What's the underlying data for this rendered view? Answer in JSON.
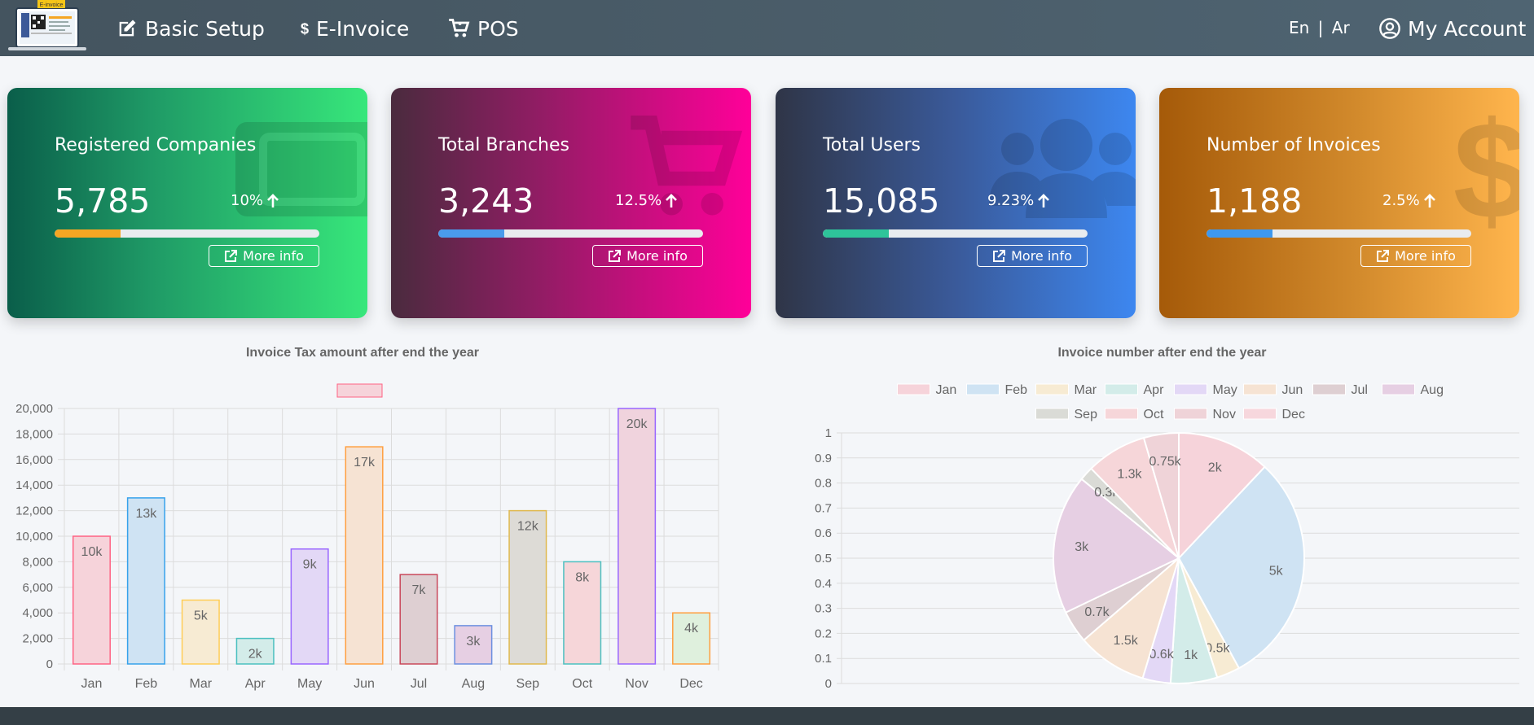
{
  "nav": {
    "logo_badge": "E-invoice",
    "items": [
      {
        "label": "Basic Setup",
        "icon": "edit-icon"
      },
      {
        "label": "E-Invoice",
        "icon": "dollar-icon"
      },
      {
        "label": "POS",
        "icon": "cart-icon"
      }
    ],
    "lang_en": "En",
    "lang_sep": "|",
    "lang_ar": "Ar",
    "account": "My Account"
  },
  "cards": [
    {
      "title": "Registered Companies",
      "value": "5,785",
      "pct": "10%",
      "progress": 0.25,
      "bar_color": "#f5a623",
      "more": "More info",
      "icon": "laptop-icon"
    },
    {
      "title": "Total Branches",
      "value": "3,243",
      "pct": "12.5%",
      "progress": 0.25,
      "bar_color": "#4a9bec",
      "more": "More info",
      "icon": "cart-icon"
    },
    {
      "title": "Total Users",
      "value": "15,085",
      "pct": "9.23%",
      "progress": 0.25,
      "bar_color": "#2ec49a",
      "more": "More info",
      "icon": "users-icon"
    },
    {
      "title": "Number of Invoices",
      "value": "1,188",
      "pct": "2.5%",
      "progress": 0.25,
      "bar_color": "#3d98ef",
      "more": "More info",
      "icon": "dollar-icon"
    }
  ],
  "chart_data": [
    {
      "type": "bar",
      "title": "Invoice Tax amount after end the year",
      "legend": [
        ""
      ],
      "categories": [
        "Jan",
        "Feb",
        "Mar",
        "Apr",
        "May",
        "Jun",
        "Jul",
        "Aug",
        "Sep",
        "Oct",
        "Nov",
        "Dec"
      ],
      "values": [
        10000,
        13000,
        5000,
        2000,
        9000,
        17000,
        7000,
        3000,
        12000,
        8000,
        20000,
        4000
      ],
      "data_labels": [
        "10k",
        "13k",
        "5k",
        "2k",
        "9k",
        "17k",
        "7k",
        "3k",
        "12k",
        "8k",
        "20k",
        "4k"
      ],
      "ylim": [
        0,
        20000
      ],
      "yticks": [
        "0",
        "2,000",
        "4,000",
        "6,000",
        "8,000",
        "10,000",
        "12,000",
        "14,000",
        "16,000",
        "18,000",
        "20,000"
      ],
      "grid": true,
      "fill_colors": [
        "#f6d3da",
        "#cfe3f3",
        "#f7ebd3",
        "#d3ece9",
        "#e3d8f6",
        "#f6e3d3",
        "#decfd2",
        "#e6cfe3",
        "#dddbd6",
        "#f6d6d9",
        "#f0d3dd",
        "#dff0dd"
      ],
      "border_colors": [
        "#ff6384",
        "#36a2eb",
        "#ffcd56",
        "#4bc0c0",
        "#9966ff",
        "#ff9f40",
        "#c9485b",
        "#6b8fe0",
        "#e0b84c",
        "#4bc0c0",
        "#9966ff",
        "#ff9f40"
      ]
    },
    {
      "type": "pie",
      "title": "Invoice number after end the year",
      "categories": [
        "Jan",
        "Feb",
        "Mar",
        "Apr",
        "May",
        "Jun",
        "Jul",
        "Aug",
        "Sep",
        "Oct",
        "Nov",
        "Dec"
      ],
      "values": [
        2000,
        5000,
        500,
        1000,
        600,
        1500,
        700,
        3000,
        300,
        1300,
        750,
        0
      ],
      "data_labels": [
        "2k",
        "5k",
        "0.5k",
        "1k",
        "0.6k",
        "1.5k",
        "0.7k",
        "3k",
        "0.3k",
        "1.3k",
        "0.75k",
        ""
      ],
      "colors": [
        "#f6d3da",
        "#cfe3f3",
        "#f7ebd3",
        "#d3ece9",
        "#e3d8f6",
        "#f6e3d3",
        "#decfd2",
        "#e6cfe3",
        "#dadbd6",
        "#f6d6d9",
        "#efd3d8",
        "#f7d7dd"
      ],
      "legend_placement": "top",
      "yticks": [
        "0",
        "0.1",
        "0.2",
        "0.3",
        "0.4",
        "0.5",
        "0.6",
        "0.7",
        "0.8",
        "0.9",
        "1"
      ],
      "grid": true
    }
  ]
}
